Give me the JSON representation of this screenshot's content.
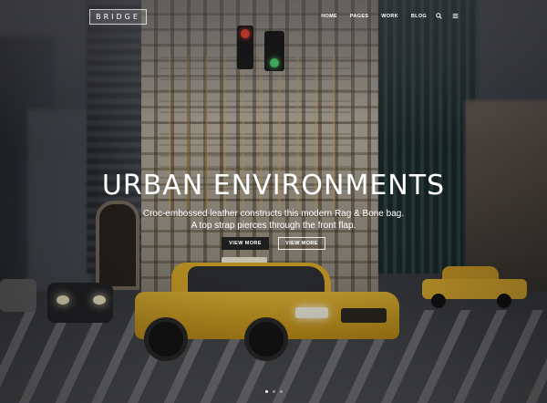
{
  "header": {
    "logo_text": "BRIDGE",
    "nav": [
      {
        "label": "HOME"
      },
      {
        "label": "PAGES"
      },
      {
        "label": "WORK"
      },
      {
        "label": "BLOG"
      }
    ],
    "icons": [
      "search-icon",
      "menu-icon"
    ]
  },
  "hero": {
    "title": "URBAN ENVIRONMENTS",
    "subtitle_lines": [
      "Croc-embossed leather constructs this modern Rag & Bone bag.",
      "A top strap pierces through the front flap."
    ],
    "buttons": [
      {
        "label": "VIEW MORE",
        "style": "filled"
      },
      {
        "label": "VIEW MORE",
        "style": "outline"
      }
    ]
  },
  "slider": {
    "total": 3,
    "active_index": 0
  },
  "colors": {
    "text": "#ffffff",
    "button_dark": "#1e1e1e",
    "taxi_yellow": "#e2b635"
  }
}
